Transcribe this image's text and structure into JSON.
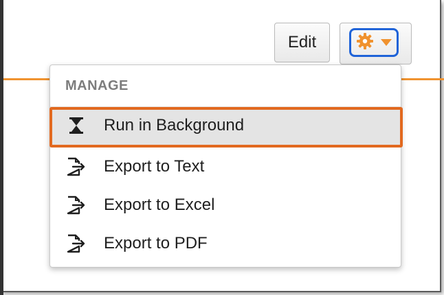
{
  "toolbar": {
    "edit_label": "Edit",
    "gear_icon": "gear-icon",
    "caret_icon": "caret-down-icon",
    "accent_color": "#f0922e",
    "focus_color": "#1f63d8"
  },
  "menu": {
    "header": "MANAGE",
    "items": [
      {
        "label": "Run in Background",
        "icon": "hourglass-icon",
        "highlighted": true
      },
      {
        "label": "Export to Text",
        "icon": "export-icon"
      },
      {
        "label": "Export to Excel",
        "icon": "export-icon"
      },
      {
        "label": "Export to PDF",
        "icon": "export-icon"
      }
    ],
    "highlight_color": "#e2691f"
  }
}
